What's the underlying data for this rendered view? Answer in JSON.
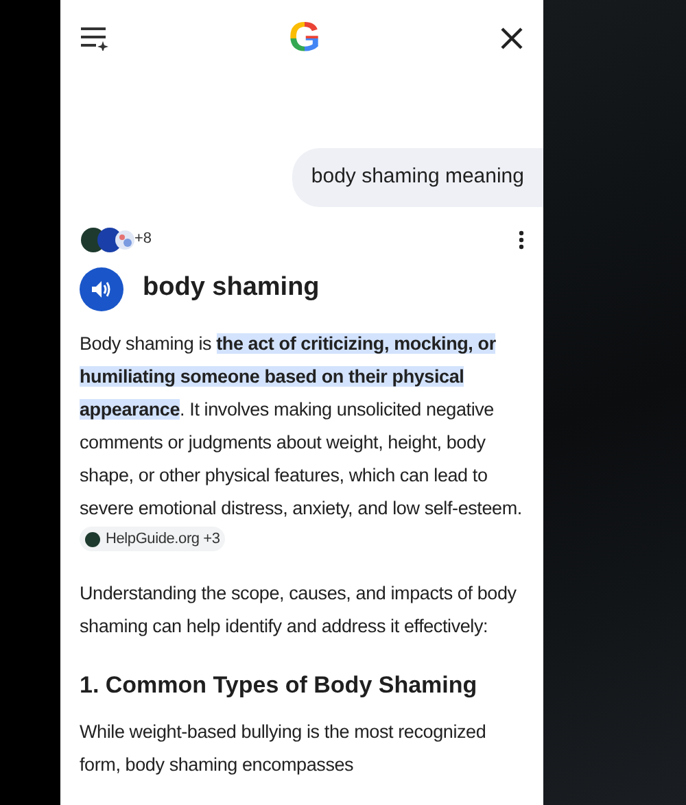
{
  "header": {
    "logo": "G"
  },
  "query": "body shaming meaning",
  "sources": {
    "count": "+8"
  },
  "term": "body shaming",
  "definition": {
    "before": "Body shaming is ",
    "highlight": "the act of criticizing, mocking, or humiliating someone based on their physical appearance",
    "after": ". It involves making unsolicited negative comments or judgments about weight, height, body shape, or other physical features, which can lead to severe emotional distress, anxiety, and low self-esteem. ",
    "source": "HelpGuide.org +3"
  },
  "intro": "Understanding the scope, causes, and impacts of body shaming can help identify and address it effectively:",
  "section_heading": "1. Common Types of Body Shaming",
  "section_text": "While weight-based bullying is the most recognized form, body shaming encompasses"
}
